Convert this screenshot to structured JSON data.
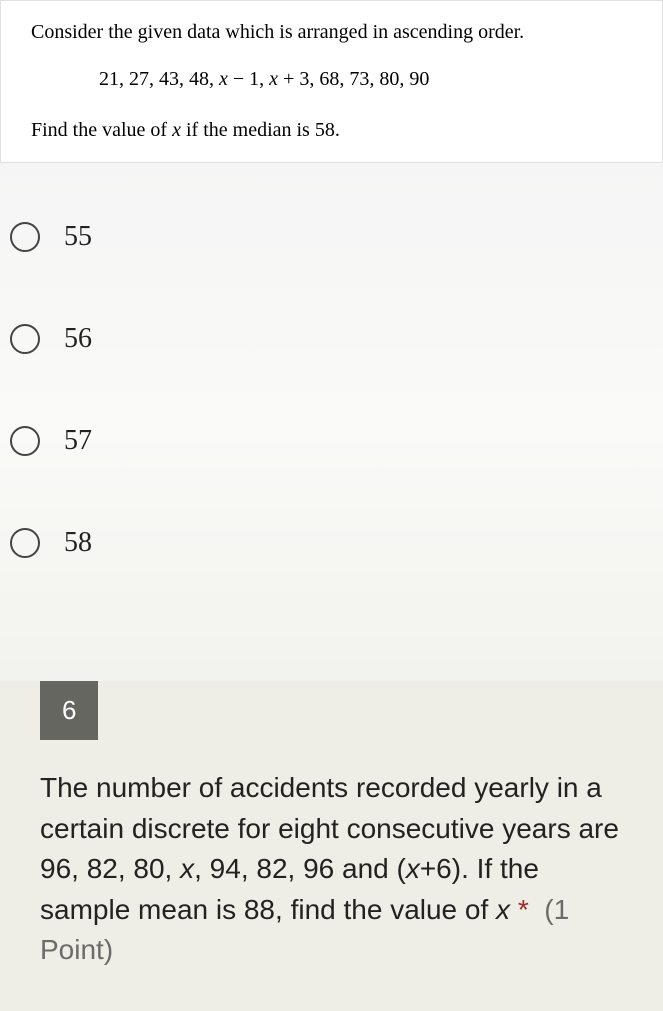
{
  "question5": {
    "prompt_line1": "Consider the given data which is arranged in ascending order.",
    "data_list": "21, 27, 43, 48, x − 1, x + 3, 68, 73, 80, 90",
    "prompt_line2_prefix": "Find the value of ",
    "prompt_line2_var": "x",
    "prompt_line2_suffix": " if the median is 58.",
    "options": [
      "55",
      "56",
      "57",
      "58"
    ]
  },
  "question6": {
    "number": "6",
    "text_part1": "The number of accidents recorded yearly in a certain discrete for eight consecutive years are 96, 82, 80, ",
    "text_var1": "x",
    "text_part2": ", 94, 82, 96 and (",
    "text_var2": "x",
    "text_part3": "+6). If the sample mean is 88, find the value of ",
    "text_var3": "x",
    "required": "*",
    "points": "(1 Point)"
  }
}
